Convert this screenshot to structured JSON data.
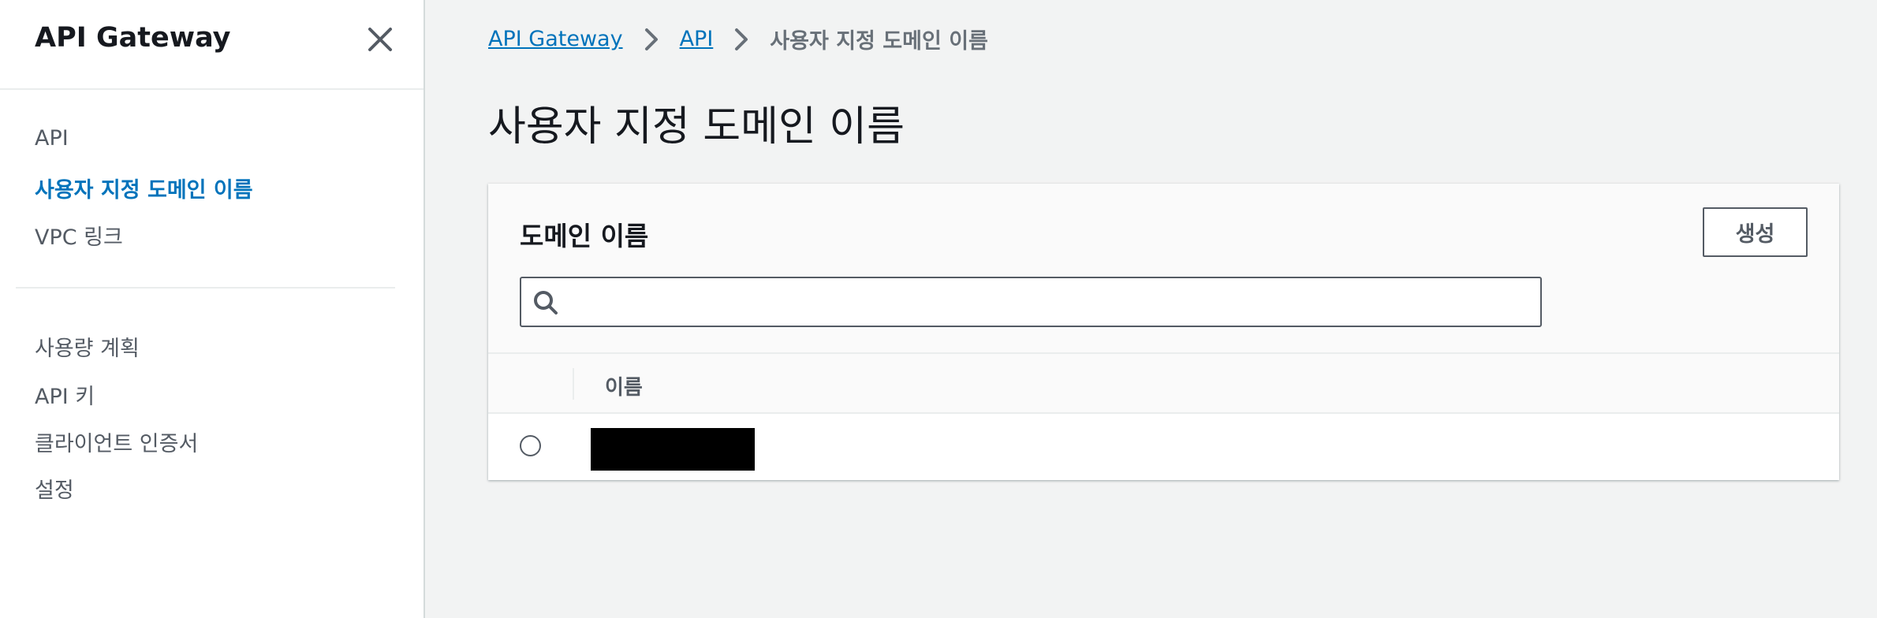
{
  "sidebar": {
    "title": "API Gateway",
    "items": [
      {
        "label": "API"
      },
      {
        "label": "사용자 지정 도메인 이름"
      },
      {
        "label": "VPC 링크"
      },
      {
        "label": "사용량 계획"
      },
      {
        "label": "API 키"
      },
      {
        "label": "클라이언트 인증서"
      },
      {
        "label": "설정"
      }
    ],
    "active_item": "사용자 지정 도메인 이름"
  },
  "breadcrumb": {
    "items": [
      "API Gateway",
      "API"
    ],
    "current": "사용자 지정 도메인 이름"
  },
  "page": {
    "title": "사용자 지정 도메인 이름"
  },
  "domain_panel": {
    "title": "도메인 이름",
    "create_label": "생성",
    "search": {
      "value": "",
      "placeholder": ""
    },
    "table": {
      "columns": [
        "이름"
      ],
      "rows": [
        {
          "selected": false,
          "name_redacted": true
        }
      ]
    }
  },
  "colors": {
    "link": "#0073bb",
    "active_nav": "#0073bb",
    "text": "#16191f",
    "secondary_text": "#545b64",
    "background": "#f2f3f3"
  }
}
